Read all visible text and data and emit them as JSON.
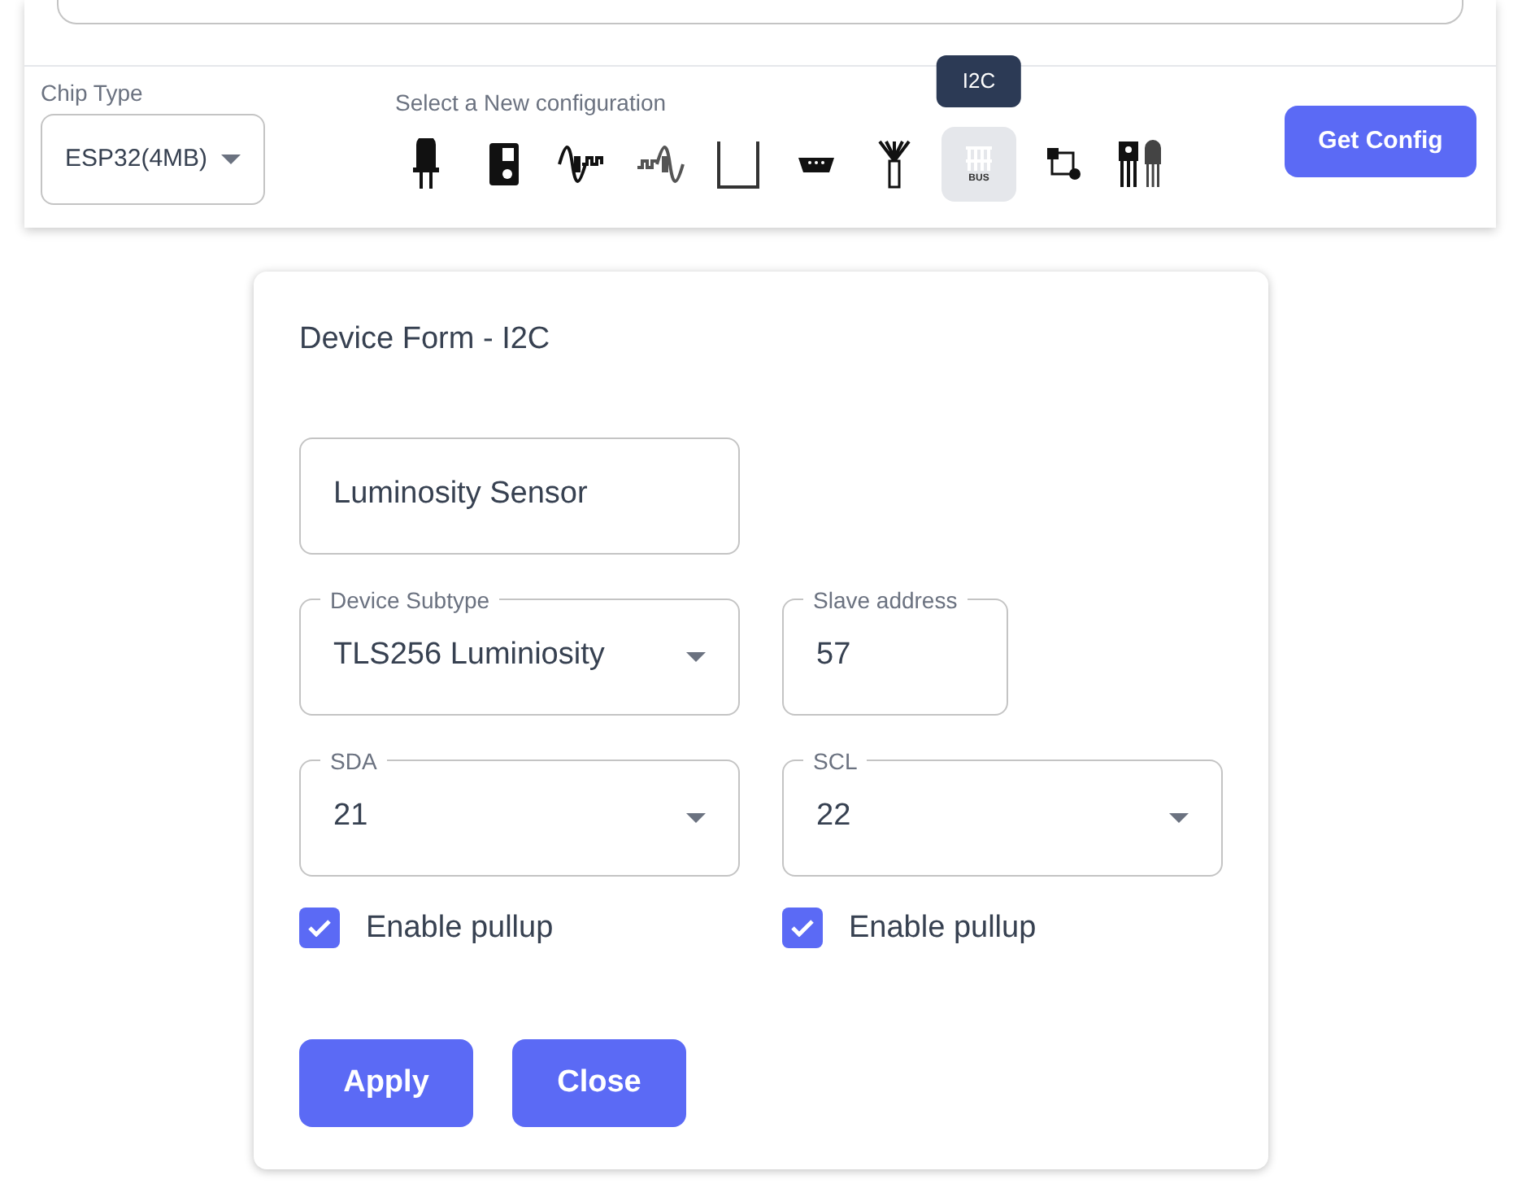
{
  "chip": {
    "label": "Chip Type",
    "value": "ESP32(4MB)"
  },
  "config": {
    "label": "Select a New configuration",
    "tooltip": "I2C",
    "items": [
      {
        "kind": "led",
        "selected": false
      },
      {
        "kind": "relay",
        "selected": false
      },
      {
        "kind": "pwm",
        "selected": false
      },
      {
        "kind": "dac",
        "selected": false
      },
      {
        "kind": "pulse",
        "selected": false
      },
      {
        "kind": "serial",
        "selected": false
      },
      {
        "kind": "antenna",
        "selected": false
      },
      {
        "kind": "bus",
        "selected": true,
        "text": "BUS"
      },
      {
        "kind": "flow",
        "selected": false
      },
      {
        "kind": "transistor",
        "selected": false
      }
    ]
  },
  "get_config": "Get Config",
  "form": {
    "title": "Device Form - I2C",
    "name": "Luminosity Sensor",
    "subtype": {
      "label": "Device Subtype",
      "value": "TLS256 Luminiosity"
    },
    "slave": {
      "label": "Slave address",
      "value": "57"
    },
    "pins": [
      {
        "label": "SDA",
        "value": "21",
        "pullup": {
          "label": "Enable pullup",
          "checked": true
        }
      },
      {
        "label": "SCL",
        "value": "22",
        "pullup": {
          "label": "Enable pullup",
          "checked": true
        }
      }
    ],
    "buttons": [
      "Apply",
      "Close"
    ]
  }
}
